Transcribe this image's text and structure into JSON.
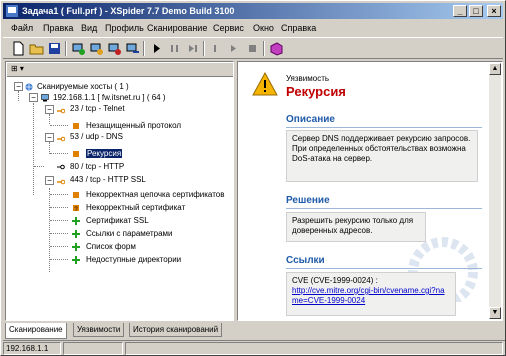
{
  "window": {
    "title": "Задача1 ( Full.prf ) - XSpider 7.7 Demo Build 3100",
    "minimize": "_",
    "maximize": "□",
    "close": "×"
  },
  "menu": [
    "Файл",
    "Правка",
    "Вид",
    "Профиль",
    "Сканирование",
    "Сервис",
    "Окно",
    "Справка"
  ],
  "tree": {
    "header_button": "⊞ ▾",
    "root": "Сканируемые хосты ( 1 )",
    "host": "192.168.1.1 [ fw.itsnet.ru ] ( 64 )",
    "ports": [
      {
        "label": "23 / tcp - Telnet",
        "children": [
          "Незащищенный протокол"
        ]
      },
      {
        "label": "53 / udp - DNS",
        "children": [
          "Рекурсия"
        ]
      },
      {
        "label": "80 / tcp - HTTP",
        "children": []
      },
      {
        "label": "443 / tcp - HTTP SSL",
        "children": [
          "Некорректная цепочка сертификатов",
          "Некорректный сертификат",
          "Сертификат SSL",
          "Ссылки с параметрами",
          "Список форм",
          "Недоступные директории"
        ]
      }
    ]
  },
  "detail": {
    "kind": "Уязвимость",
    "name": "Рекурсия",
    "description_title": "Описание",
    "description": "Сервер DNS поддерживает рекурсию запросов. При определенных обстоятельствах возможна DoS-атака на сервер.",
    "solution_title": "Решение",
    "solution": "Разрешить рекурсию только для доверенных адресов.",
    "links_title": "Ссылки",
    "cve": "CVE (CVE-1999-0024) :",
    "cve_link": "http://cve.mitre.org/cgi-bin/cvename.cgi?name=CVE-1999-0024"
  },
  "tabs": [
    "Сканирование",
    "Уязвимости",
    "История сканирований"
  ],
  "status": {
    "address": "192.168.1.1"
  },
  "colors": {
    "title_bar": "#0a246a",
    "accent_red": "#c00000",
    "section_blue": "#1f5aa8",
    "selection": "#0a246a"
  }
}
